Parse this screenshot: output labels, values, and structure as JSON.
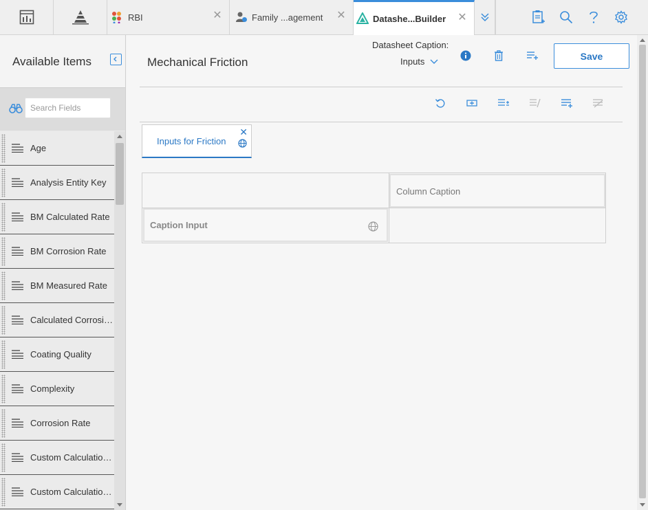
{
  "topbar": {
    "tabs": [
      {
        "label": "RBI",
        "icon": "rbi-dots-icon"
      },
      {
        "label": "Family ...agement",
        "icon": "family-management-icon"
      },
      {
        "label": "Datashe...Builder",
        "icon": "datasheet-builder-icon",
        "active": true
      }
    ]
  },
  "sidebar": {
    "title": "Available Items",
    "search_placeholder": "Search Fields",
    "items": [
      {
        "label": "Age"
      },
      {
        "label": "Analysis Entity Key"
      },
      {
        "label": "BM Calculated Rate"
      },
      {
        "label": "BM Corrosion Rate"
      },
      {
        "label": "BM Measured Rate"
      },
      {
        "label": "Calculated Corrosion..."
      },
      {
        "label": "Coating Quality"
      },
      {
        "label": "Complexity"
      },
      {
        "label": "Corrosion Rate"
      },
      {
        "label": "Custom Calculation P..."
      },
      {
        "label": "Custom Calculation U..."
      }
    ]
  },
  "main": {
    "title": "Mechanical Friction",
    "caption_label": "Datasheet Caption:",
    "caption_value": "Inputs",
    "save_label": "Save",
    "datasheet_tab": "Inputs for Friction",
    "grid": {
      "column_caption": "Column Caption",
      "row_caption": "Caption Input"
    }
  },
  "colors": {
    "accent": "#3a8ddb",
    "accent_dark": "#2a78c5",
    "sidebar_bg": "#e9e9e9"
  }
}
